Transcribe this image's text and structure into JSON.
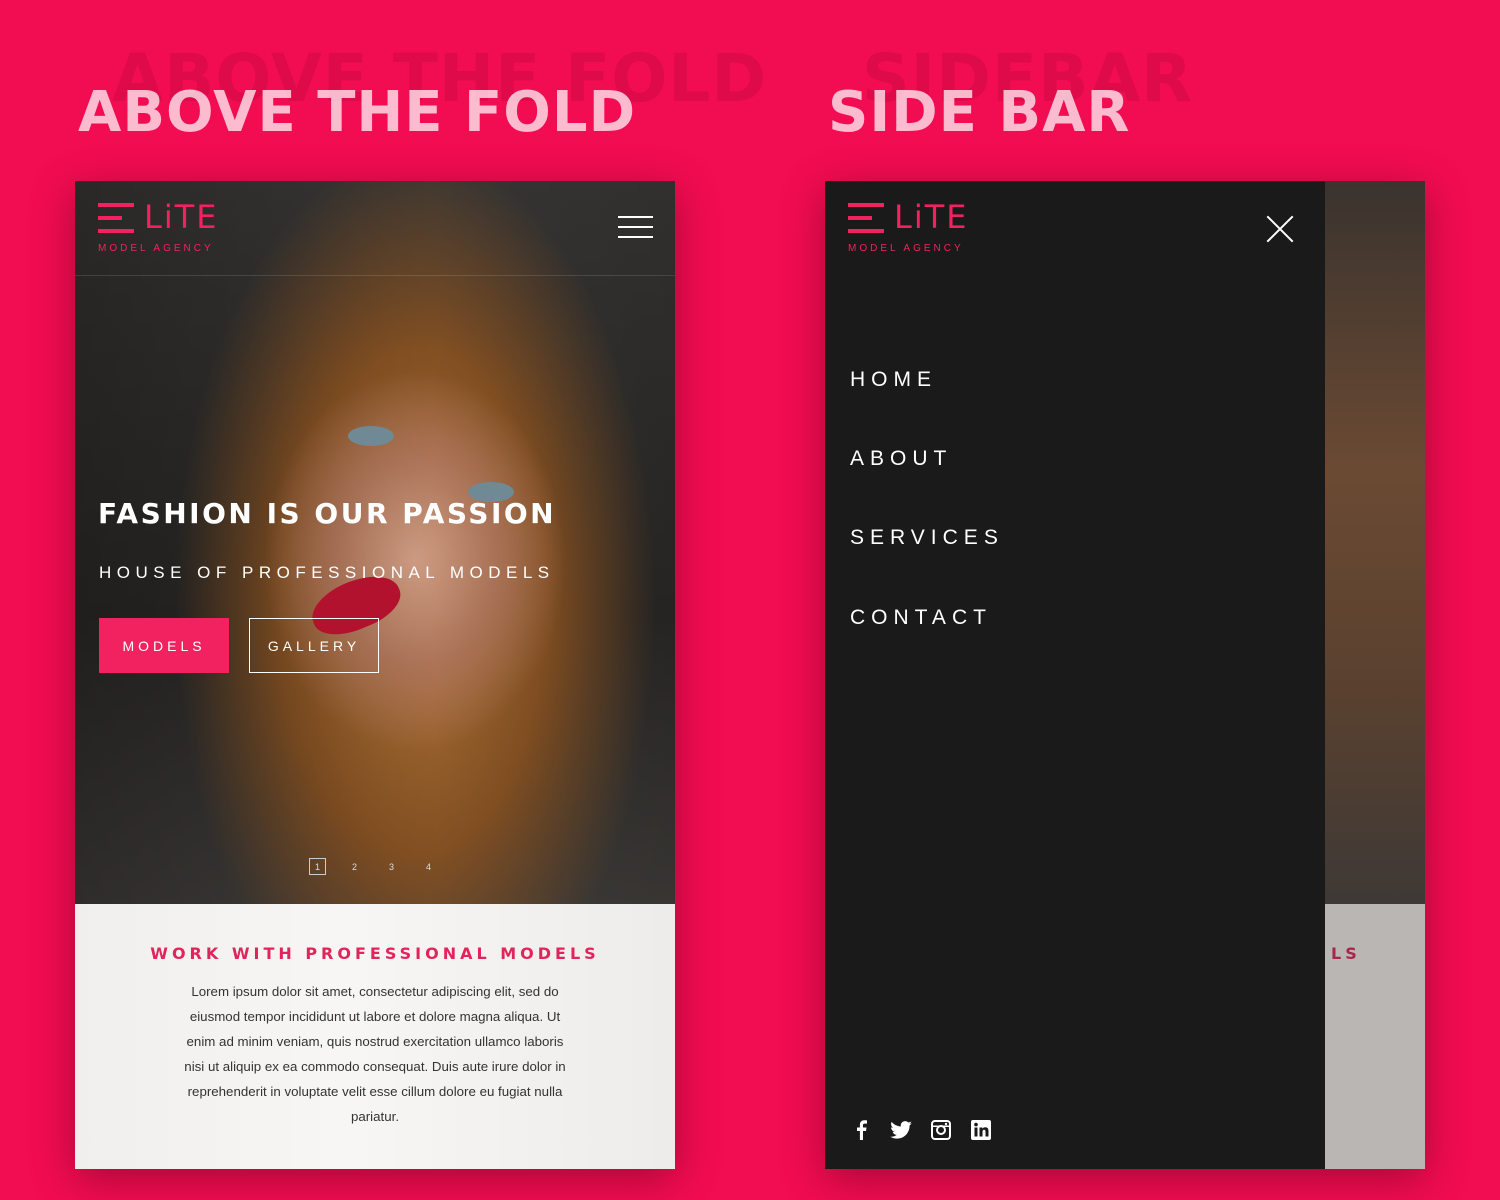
{
  "sections": {
    "left": {
      "heading": "ABOVE THE FOLD",
      "ghost": "ABOVE THE FOLD"
    },
    "right": {
      "heading": "SIDE BAR",
      "ghost": "SIDEBAR"
    }
  },
  "logo": {
    "word": "LiTE",
    "tagline": "MODEL AGENCY"
  },
  "hero": {
    "title": "FASHION IS OUR PASSION",
    "subtitle": "HOUSE OF PROFESSIONAL MODELS",
    "buttons": {
      "models": "MODELS",
      "gallery": "GALLERY"
    },
    "pager": [
      "1",
      "2",
      "3",
      "4"
    ],
    "active_page": 1
  },
  "work": {
    "title": "WORK WITH PROFESSIONAL MODELS",
    "body": "Lorem ipsum dolor sit amet, consectetur adipiscing elit, sed do eiusmod tempor incididunt ut labore et dolore magna aliqua. Ut enim ad minim veniam, quis nostrud exercitation ullamco laboris nisi ut aliquip ex ea commodo consequat. Duis aute irure dolor in reprehenderit in voluptate velit esse cillum dolore eu fugiat nulla pariatur."
  },
  "sidebar": {
    "nav": [
      "HOME",
      "ABOUT",
      "SERVICES",
      "CONTACT"
    ],
    "peek_text": "LS",
    "social": [
      "facebook-icon",
      "twitter-icon",
      "instagram-icon",
      "linkedin-icon"
    ]
  },
  "colors": {
    "background": "#f20c51",
    "accent": "#f2215f",
    "drawer": "#1a1a1a"
  }
}
